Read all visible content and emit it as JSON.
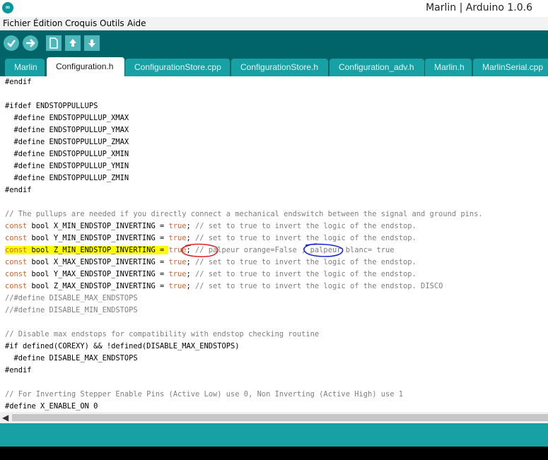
{
  "window": {
    "title": "Marlin | Arduino 1.0.6",
    "app_logo": "∞"
  },
  "menu": [
    "Fichier",
    "Édition",
    "Croquis",
    "Outils",
    "Aide"
  ],
  "toolbar": {
    "icons": [
      "verify-icon",
      "upload-icon",
      "new-icon",
      "open-icon",
      "save-icon"
    ]
  },
  "tabs": [
    {
      "label": "Marlin",
      "active": false
    },
    {
      "label": "Configuration.h",
      "active": true
    },
    {
      "label": "ConfigurationStore.cpp",
      "active": false
    },
    {
      "label": "ConfigurationStore.h",
      "active": false
    },
    {
      "label": "Configuration_adv.h",
      "active": false
    },
    {
      "label": "Marlin.h",
      "active": false
    },
    {
      "label": "MarlinSerial.cpp",
      "active": false
    }
  ],
  "code": {
    "l1": "#endif",
    "l3": "#ifdef ENDSTOPPULLUPS",
    "l4": "  #define ENDSTOPPULLUP_XMAX",
    "l5": "  #define ENDSTOPPULLUP_YMAX",
    "l6": "  #define ENDSTOPPULLUP_ZMAX",
    "l7": "  #define ENDSTOPPULLUP_XMIN",
    "l8": "  #define ENDSTOPPULLUP_YMIN",
    "l9": "  #define ENDSTOPPULLUP_ZMIN",
    "l10": "#endif",
    "l12": "// The pullups are needed if you directly connect a mechanical endswitch between the signal and ground pins.",
    "l13": {
      "kw": "const",
      "decl": " bool X_MIN_ENDSTOP_INVERTING = ",
      "val": "true",
      "rest": ";",
      "cm": " // set to true to invert the logic of the endstop."
    },
    "l14": {
      "kw": "const",
      "decl": " bool Y_MIN_ENDSTOP_INVERTING = ",
      "val": "true",
      "rest": ";",
      "cm": " // set to true to invert the logic of the endstop."
    },
    "l15": {
      "kw": "const",
      "decl": " bool Z_MIN_ENDSTOP_INVERTING = ",
      "val": "true",
      "rest": ";",
      "cm": " // palpeur orange=False ; palpeur blanc= true"
    },
    "l16": {
      "kw": "const",
      "decl": " bool X_MAX_ENDSTOP_INVERTING = ",
      "val": "true",
      "rest": ";",
      "cm": " // set to true to invert the logic of the endstop."
    },
    "l17": {
      "kw": "const",
      "decl": " bool Y_MAX_ENDSTOP_INVERTING = ",
      "val": "true",
      "rest": ";",
      "cm": " // set to true to invert the logic of the endstop."
    },
    "l18": {
      "kw": "const",
      "decl": " bool Z_MAX_ENDSTOP_INVERTING = ",
      "val": "true",
      "rest": ";",
      "cm": " // set to true to invert the logic of the endstop. DISCO"
    },
    "l19": "//#define DISABLE_MAX_ENDSTOPS",
    "l20": "//#define DISABLE_MIN_ENDSTOPS",
    "l22": "// Disable max endstops for compatibility with endstop checking routine",
    "l23": "#if defined(COREXY) && !defined(DISABLE_MAX_ENDSTOPS)",
    "l24": "  #define DISABLE_MAX_ENDSTOPS",
    "l25": "#endif",
    "l27": "// For Inverting Stepper Enable Pins (Active Low) use 0, Non Inverting (Active High) use 1",
    "l28": "#define X_ENABLE_ON 0"
  },
  "colors": {
    "accent": "#006468",
    "tab": "#17a1a5",
    "highlight": "#ffff00",
    "keyword": "#cc6633",
    "comment": "#7e7e7e",
    "red_mark": "#e02020",
    "blue_mark": "#1a2ad0"
  }
}
